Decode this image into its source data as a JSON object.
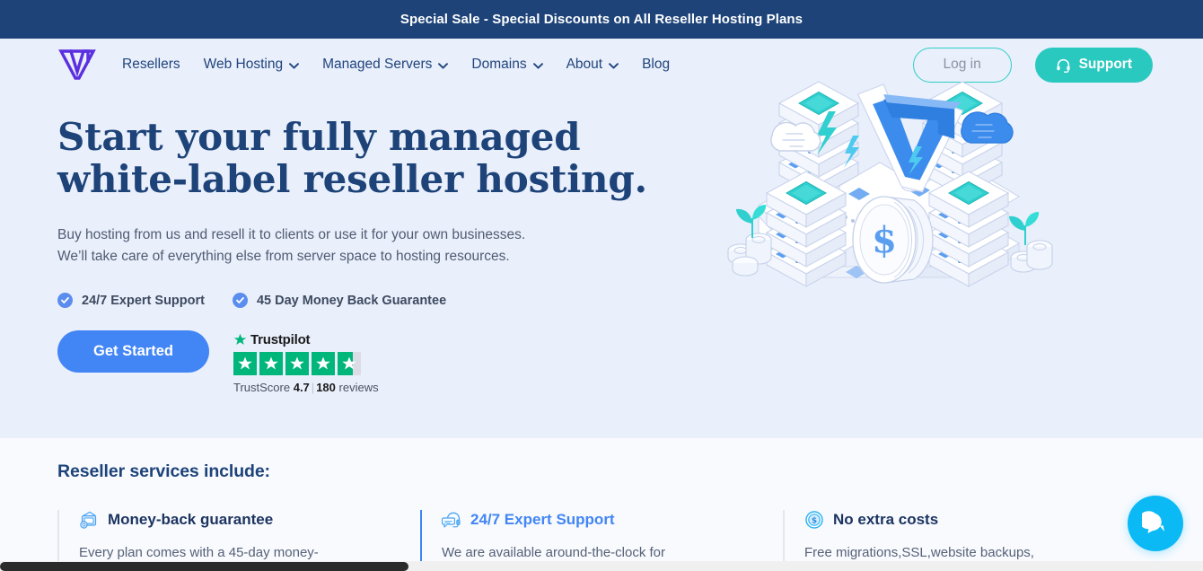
{
  "announcement": {
    "text": "Special Sale - Special Discounts on All Reseller Hosting Plans",
    "bg_color": "#1d4379"
  },
  "header": {
    "logo_name": "brand-logo",
    "nav": [
      {
        "label": "Resellers",
        "has_dropdown": false
      },
      {
        "label": "Web Hosting",
        "has_dropdown": true
      },
      {
        "label": "Managed Servers",
        "has_dropdown": true
      },
      {
        "label": "Domains",
        "has_dropdown": true
      },
      {
        "label": "About",
        "has_dropdown": true
      },
      {
        "label": "Blog",
        "has_dropdown": false
      }
    ],
    "login_label": "Log in",
    "support_label": "Support",
    "accent_color": "#2ac9c0"
  },
  "hero": {
    "title_line1": "Start your fully managed",
    "title_line2": "white-label reseller hosting.",
    "subtitle_line1": "Buy hosting from us and resell it to clients or use it for your own businesses.",
    "subtitle_line2": "We’ll take care of everything else from server space to hosting resources.",
    "checks": [
      "24/7 Expert Support",
      "45 Day Money Back Guarantee"
    ],
    "cta_label": "Get Started",
    "cta_color": "#4285f4",
    "title_color": "#1d4379",
    "bg_color": "#e9effb"
  },
  "trustpilot": {
    "brand": "Trustpilot",
    "stars_total": 5,
    "stars_filled": 4.65,
    "score_prefix": "TrustScore",
    "score": "4.7",
    "reviews_count": "180",
    "reviews_suffix": "reviews",
    "star_color": "#00b67a"
  },
  "services": {
    "heading": "Reseller services include:",
    "cards": [
      {
        "icon": "money-back-icon",
        "title": "Money-back guarantee",
        "text": "Every plan comes with a 45-day money-",
        "active": false
      },
      {
        "icon": "headset-icon",
        "title": "24/7 Expert Support",
        "text": "We are available around-the-clock for",
        "active": true
      },
      {
        "icon": "dollar-coin-icon",
        "title": "No extra costs",
        "text": "Free migrations,SSL,website backups,",
        "active": false
      }
    ]
  },
  "chat": {
    "name": "chat-widget",
    "color": "#0bb9f5"
  }
}
